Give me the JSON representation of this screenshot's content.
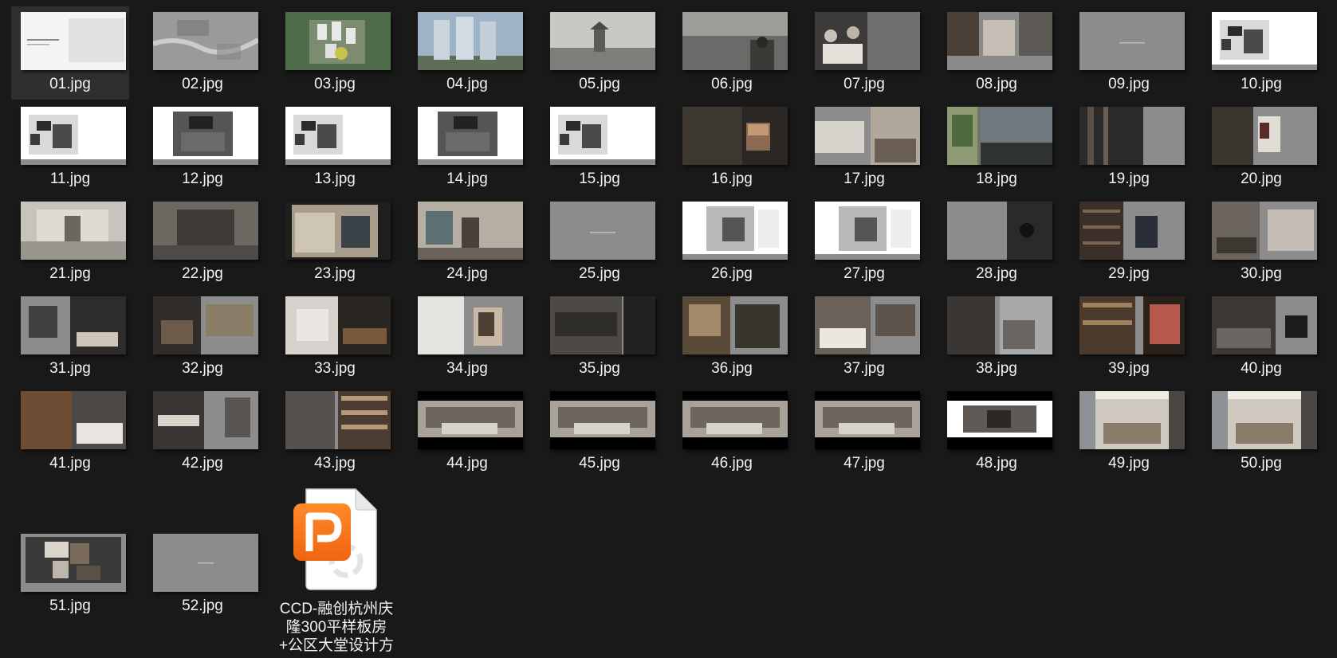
{
  "window": {
    "background": "#191919"
  },
  "files": [
    {
      "name": "01.jpg",
      "kind": "title-white",
      "selected": true
    },
    {
      "name": "02.jpg",
      "kind": "map"
    },
    {
      "name": "03.jpg",
      "kind": "aerial"
    },
    {
      "name": "04.jpg",
      "kind": "towers"
    },
    {
      "name": "05.jpg",
      "kind": "skyline"
    },
    {
      "name": "06.jpg",
      "kind": "city-dark"
    },
    {
      "name": "07.jpg",
      "kind": "people"
    },
    {
      "name": "08.jpg",
      "kind": "interior-collage"
    },
    {
      "name": "09.jpg",
      "kind": "gray-text"
    },
    {
      "name": "10.jpg",
      "kind": "plan-white"
    },
    {
      "name": "11.jpg",
      "kind": "plan-white"
    },
    {
      "name": "12.jpg",
      "kind": "plan-gray"
    },
    {
      "name": "13.jpg",
      "kind": "plan-white"
    },
    {
      "name": "14.jpg",
      "kind": "plan-gray"
    },
    {
      "name": "15.jpg",
      "kind": "plan-white"
    },
    {
      "name": "16.jpg",
      "kind": "dark-interior"
    },
    {
      "name": "17.jpg",
      "kind": "interior-split"
    },
    {
      "name": "18.jpg",
      "kind": "garden"
    },
    {
      "name": "19.jpg",
      "kind": "dark-corridor"
    },
    {
      "name": "20.jpg",
      "kind": "gray-split"
    },
    {
      "name": "21.jpg",
      "kind": "lobby"
    },
    {
      "name": "22.jpg",
      "kind": "lobby-dark"
    },
    {
      "name": "23.jpg",
      "kind": "lobby-warm"
    },
    {
      "name": "24.jpg",
      "kind": "lobby-art"
    },
    {
      "name": "25.jpg",
      "kind": "gray-text"
    },
    {
      "name": "26.jpg",
      "kind": "plan-color"
    },
    {
      "name": "27.jpg",
      "kind": "plan-color"
    },
    {
      "name": "28.jpg",
      "kind": "gray-door"
    },
    {
      "name": "29.jpg",
      "kind": "shelf"
    },
    {
      "name": "30.jpg",
      "kind": "living"
    },
    {
      "name": "31.jpg",
      "kind": "living-dark"
    },
    {
      "name": "32.jpg",
      "kind": "collage-dark"
    },
    {
      "name": "33.jpg",
      "kind": "dining"
    },
    {
      "name": "34.jpg",
      "kind": "art-gray"
    },
    {
      "name": "35.jpg",
      "kind": "kitchen"
    },
    {
      "name": "36.jpg",
      "kind": "collage-warm"
    },
    {
      "name": "37.jpg",
      "kind": "bedroom"
    },
    {
      "name": "38.jpg",
      "kind": "bath"
    },
    {
      "name": "39.jpg",
      "kind": "closet"
    },
    {
      "name": "40.jpg",
      "kind": "bedroom-dark"
    },
    {
      "name": "41.jpg",
      "kind": "bedroom-split"
    },
    {
      "name": "42.jpg",
      "kind": "bath-split"
    },
    {
      "name": "43.jpg",
      "kind": "study"
    },
    {
      "name": "44.jpg",
      "kind": "pano-black"
    },
    {
      "name": "45.jpg",
      "kind": "pano-black"
    },
    {
      "name": "46.jpg",
      "kind": "pano-black"
    },
    {
      "name": "47.jpg",
      "kind": "pano-black"
    },
    {
      "name": "48.jpg",
      "kind": "pano-white"
    },
    {
      "name": "49.jpg",
      "kind": "pano-bed"
    },
    {
      "name": "50.jpg",
      "kind": "pano-bed"
    }
  ],
  "extra_files": [
    {
      "name": "51.jpg",
      "kind": "material-board"
    },
    {
      "name": "52.jpg",
      "kind": "gray-end"
    }
  ],
  "pdf_file": {
    "name": "CCD-融创杭州庆隆300平样板房+公区大堂设计方",
    "icon": "wps-pdf-icon",
    "accent": "#f7741a"
  }
}
